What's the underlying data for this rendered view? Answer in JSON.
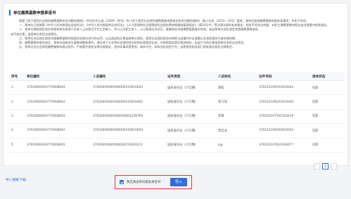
{
  "header": {
    "title": "单位缴费基数申报承诺书"
  },
  "pledge": {
    "lines": [
      {
        "text": "根据《关于规范社会保险缴费基数有关问题的通知》（劳社险中心函〔2006〕60号）和《关于规范社会保险缴费基数申报核定有关问题的通知》（青人社发〔2015〕33号）要求，我单位现就缴费基数申报有关事项，作如下承诺：",
        "indent": true
      },
      {
        "text": "一、我单位已经按照《中华人民共和国社会保险法》、《中华人民共和国劳动合同法》、《人力资源和社会保障部社会保险费申报缴纳管理规定》（第20号令）等法律法规的有关规定，相关手续合法完备，对职工缴费基数申报业务办理遵守相关规定。",
        "indent": true
      },
      {
        "text": "二、我单位按照规定如实申报本单位参保人员本人上年度月平均工资收入，并公示至职工本人，公示期满无异议后，能够保证申报缴费基数真实有效，若因我单位违反规定申报缴费基数造成",
        "indent": true
      },
      {
        "text": "成不良后果，由我单位承担全部责任。",
        "indent": false
      },
      {
        "text": "三、我单位对因违反规定申报缴费基数并根据实际情况进行的处罚，以及造成的后果由我单位承担，接受社会保险经办机构依法追缴并补足差额以及其他相关行政处理结果。",
        "indent": true
      },
      {
        "text": "四、缴费基数申报完成后，我单位因故发生基数调整变更的，通过线下方式到社会保险经办机构办理相关业务，并按照规定提交相关材料，由此产生的后果由我单位承担全部责任。",
        "indent": true
      },
      {
        "text": "五、我单位在社会保险缴费基数申报过程中，严格遵守相关法律法规规定，坚持实事求是原则，诚实守信，如有违反规定行为，自愿接受相关部门的处理及相应法律责任。",
        "indent": true
      }
    ]
  },
  "table": {
    "columns": [
      "序号",
      "单位编号",
      "人员编号",
      "证件类型",
      "人员姓名",
      "证件号码",
      "退休状态"
    ],
    "rows": [
      [
        "1",
        "37020000003770008002",
        "37020000000000000150016003",
        "居民身份证（户口簿）",
        "郭松",
        "370101199101010043",
        "在职"
      ],
      [
        "2",
        "37020000003770008002",
        "37020000000000000150016002",
        "居民身份证（户口簿）",
        "李三风",
        "370101199201010043",
        "在职"
      ],
      [
        "3",
        "37020000003770008002",
        "37020000000000000002239769",
        "居民身份证（户口簿）",
        "李翠",
        "370203197505163619",
        "在职"
      ],
      [
        "4",
        "37020000003770008002",
        "37020000000000000150016004",
        "居民身份证（户口簿）",
        "李云龙",
        "370101199205010043",
        "在职"
      ],
      [
        "5",
        "37020000003770008002",
        "37020000000000000150016011",
        "居民身份证（户口簿）",
        "pig",
        "370202197610100677",
        "在职"
      ]
    ]
  },
  "pagination": {
    "prev": "‹",
    "current": "1",
    "next": "›"
  },
  "footer": {
    "import_template": "导入模板下载",
    "agree_label": "我已阅读并同意此承诺书",
    "import_button": "导入"
  },
  "colors": {
    "accent": "#2f6fdc",
    "highlight_border": "#e53935"
  }
}
